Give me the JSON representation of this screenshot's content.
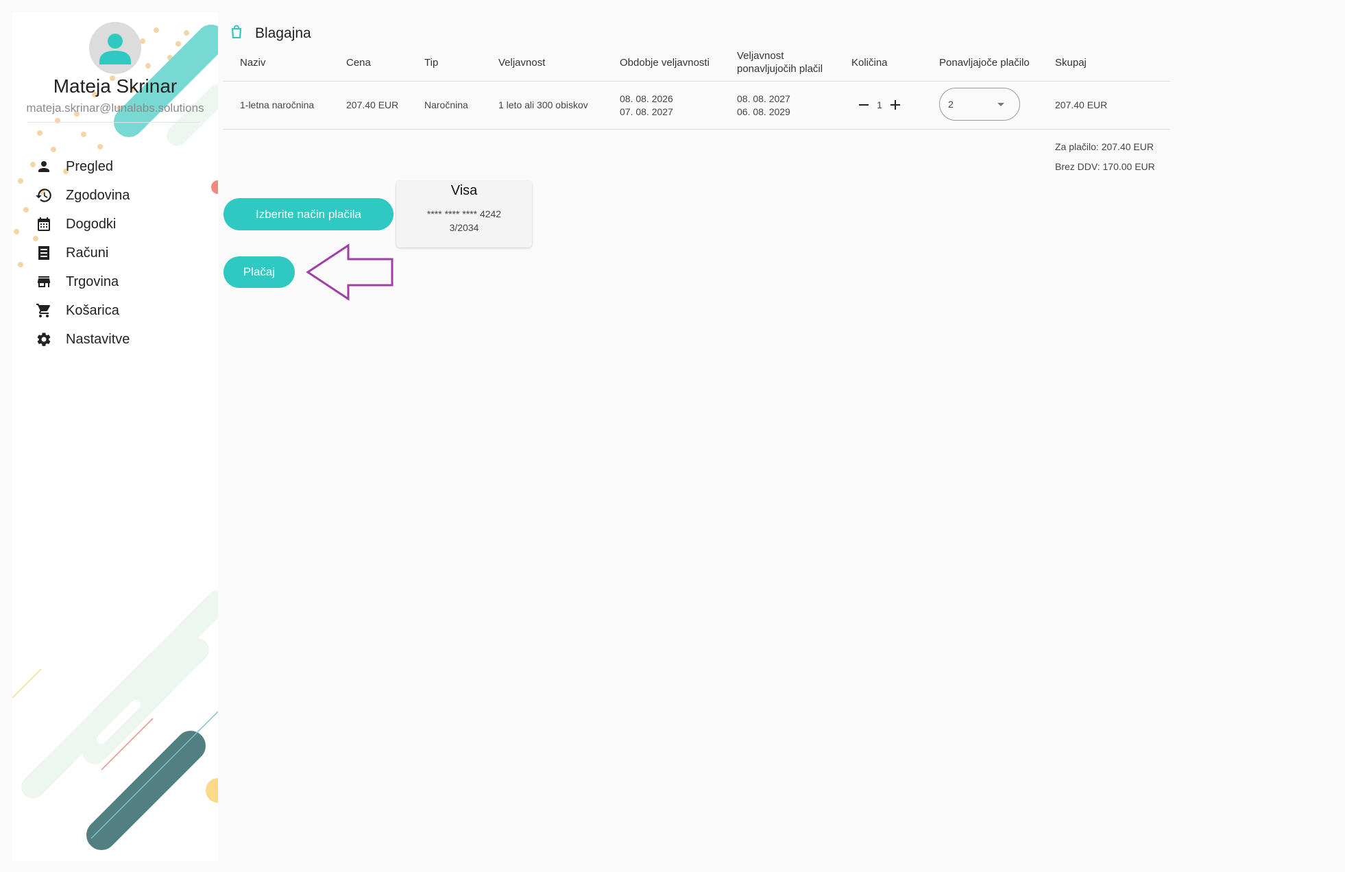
{
  "user": {
    "name": "Mateja Skrinar",
    "email": "mateja.skrinar@lunalabs.solutions"
  },
  "sidebar": {
    "items": [
      {
        "label": "Pregled",
        "icon": "person-icon"
      },
      {
        "label": "Zgodovina",
        "icon": "history-icon"
      },
      {
        "label": "Dogodki",
        "icon": "calendar-icon"
      },
      {
        "label": "Računi",
        "icon": "receipt-icon"
      },
      {
        "label": "Trgovina",
        "icon": "store-icon"
      },
      {
        "label": "Košarica",
        "icon": "cart-icon"
      },
      {
        "label": "Nastavitve",
        "icon": "gear-icon"
      }
    ]
  },
  "page": {
    "title": "Blagajna",
    "icon": "shopping-bag-icon"
  },
  "table": {
    "headers": {
      "name": "Naziv",
      "price": "Cena",
      "type": "Tip",
      "validity": "Veljavnost",
      "period": "Obdobje veljavnosti",
      "recurring_validity_1": "Veljavnost",
      "recurring_validity_2": "ponavljujočih plačil",
      "quantity": "Količina",
      "recurring_payment": "Ponavljajoče plačilo",
      "total": "Skupaj"
    },
    "rows": [
      {
        "name": "1-letna naročnina",
        "price": "207.40 EUR",
        "type": "Naročnina",
        "validity": "1 leto ali 300 obiskov",
        "period_start": "08. 08. 2026",
        "period_end": "07. 08. 2027",
        "recurring_start": "08. 08. 2027",
        "recurring_end": "06. 08. 2029",
        "quantity": "1",
        "recurring_payment": "2",
        "total": "207.40 EUR"
      }
    ]
  },
  "totals": {
    "to_pay": "Za plačilo: 207.40 EUR",
    "without_vat": "Brez DDV: 170.00 EUR"
  },
  "actions": {
    "choose_payment_label": "Izberite način plačila",
    "pay_label": "Plačaj"
  },
  "card": {
    "brand": "Visa",
    "number": "**** **** **** 4242",
    "expiry": "3/2034"
  },
  "colors": {
    "accent": "#2ecac2",
    "annotation_arrow": "#a03fa6"
  }
}
